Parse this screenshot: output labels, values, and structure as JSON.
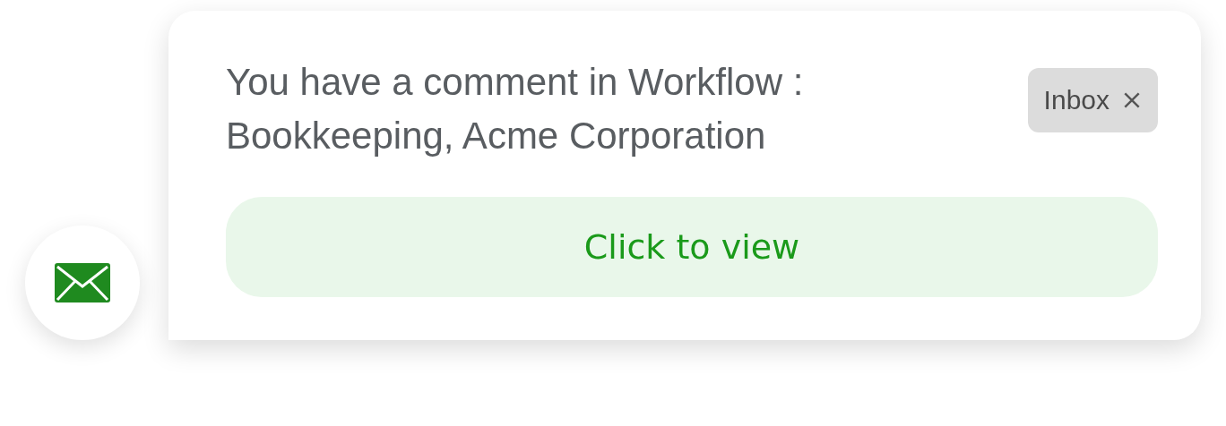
{
  "notification": {
    "message": "You have a comment in Workflow : Bookkeeping, Acme Corporation",
    "tag": {
      "label": "Inbox"
    },
    "action": {
      "label": "Click to view"
    }
  }
}
